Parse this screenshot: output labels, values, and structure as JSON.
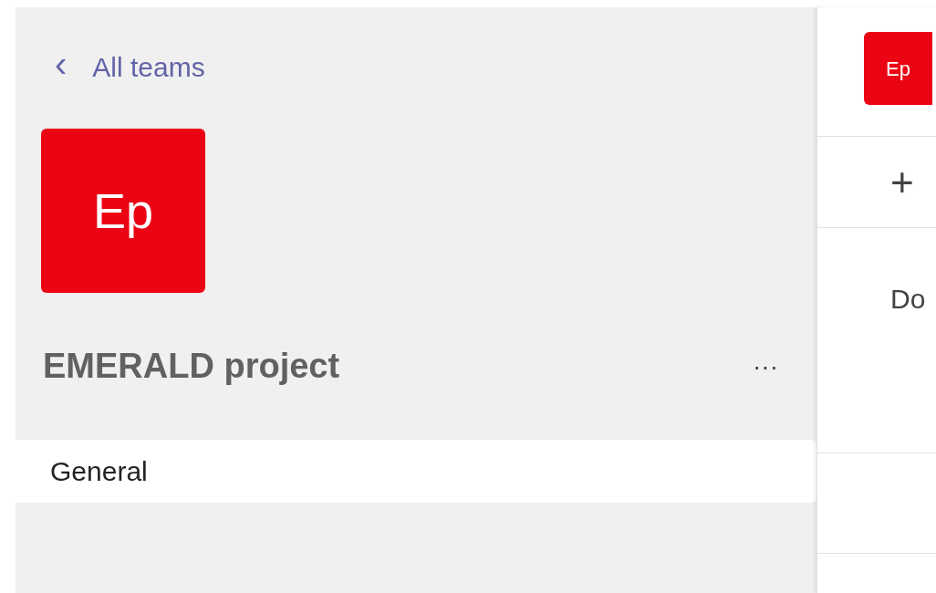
{
  "back_link": {
    "icon": "‹",
    "label": "All teams"
  },
  "team": {
    "avatar": "Ep",
    "color": "#eb0413",
    "name": "EMERALD project",
    "more": "···"
  },
  "channels": [
    {
      "label": "General",
      "selected": true
    }
  ],
  "right_panel": {
    "avatar": "Ep",
    "add": "+",
    "text": "Do"
  }
}
